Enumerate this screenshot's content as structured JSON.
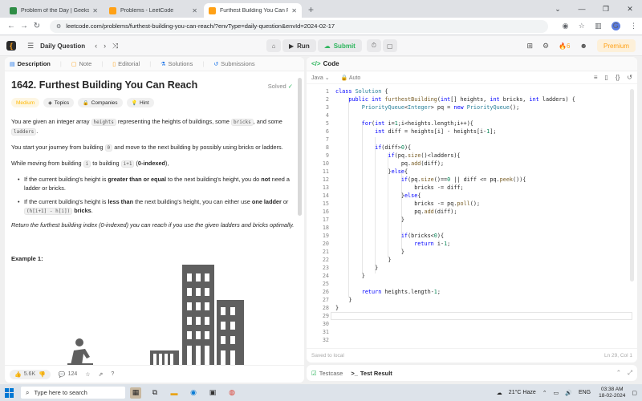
{
  "browser": {
    "tabs": [
      {
        "title": "Problem of the Day | GeeksforG",
        "color": "#2f8d46"
      },
      {
        "title": "Problems - LeetCode",
        "color": "#ffa116"
      },
      {
        "title": "Furthest Building You Can Reach",
        "color": "#ffa116"
      }
    ],
    "url": "leetcode.com/problems/furthest-building-you-can-reach/?envType=daily-question&envId=2024-02-17",
    "profile_initial": "G"
  },
  "lcnav": {
    "daily_label": "Daily Question",
    "run_label": "Run",
    "submit_label": "Submit",
    "streak": "6",
    "premium_label": "Premium"
  },
  "left": {
    "tabs": [
      "Description",
      "Note",
      "Editorial",
      "Solutions",
      "Submissions"
    ],
    "title": "1642. Furthest Building You Can Reach",
    "solved": "Solved",
    "tags": [
      "Medium",
      "Topics",
      "Companies",
      "Hint"
    ],
    "p1": {
      "a": "You are given an integer array ",
      "c1": "heights",
      "b": " representing the heights of buildings, some ",
      "c2": "bricks",
      "c": ", and some ",
      "c3": "ladders",
      "d": "."
    },
    "p2": {
      "a": "You start your journey from building ",
      "c1": "0",
      "b": " and move to the next building by possibly using bricks or ladders."
    },
    "p3": {
      "a": "While moving from building ",
      "c1": "i",
      "b": " to building ",
      "c2": "i+1",
      "c": " (",
      "bold": "0-indexed",
      "d": "),"
    },
    "b1": {
      "a": "If the current building's height is ",
      "bold1": "greater than or equal",
      "b": " to the next building's height, you do ",
      "bold2": "not",
      "c": " need a ladder or bricks."
    },
    "b2": {
      "a": "If the current building's height is ",
      "bold1": "less than",
      "b": " the next building's height, you can either use ",
      "bold2": "one ladder",
      "c": " or ",
      "code": "(h[i+1] - h[i])",
      "bold3": "bricks",
      "d": "."
    },
    "italic": "Return the furthest building index (0-indexed) you can reach if you use the given ladders and bricks optimally.",
    "example": "Example 1:",
    "likes": "5.6K",
    "comments": "124"
  },
  "right": {
    "header": "Code",
    "language": "Java",
    "auto": "Auto",
    "code_lines": [
      "class Solution {",
      "    public int furthestBuilding(int[] heights, int bricks, int ladders) {",
      "        PriorityQueue<Integer> pq = new PriorityQueue();",
      "",
      "        for(int i=1;i<heights.length;i++){",
      "            int diff = heights[i] - heights[i-1];",
      "",
      "            if(diff>0){",
      "                if(pq.size()<ladders){",
      "                    pq.add(diff);",
      "                }else{",
      "                    if(pq.size()==0 || diff <= pq.peek()){",
      "                        bricks -= diff;",
      "                    }else{",
      "                        bricks -= pq.poll();",
      "                        pq.add(diff);",
      "                    }",
      "",
      "                    if(bricks<0){",
      "                        return i-1;",
      "                    }",
      "                }",
      "            }",
      "        }",
      "",
      "        return heights.length-1;",
      "    }",
      "}",
      "",
      "",
      "",
      ""
    ],
    "saved": "Saved to local",
    "cursor": "Ln 29, Col 1"
  },
  "bottom": {
    "testcase": "Testcase",
    "result": "Test Result"
  },
  "taskbar": {
    "search_placeholder": "Type here to search",
    "weather": "21°C Haze",
    "lang": "ENG",
    "time": "03:38 AM",
    "date": "18-02-2024"
  }
}
